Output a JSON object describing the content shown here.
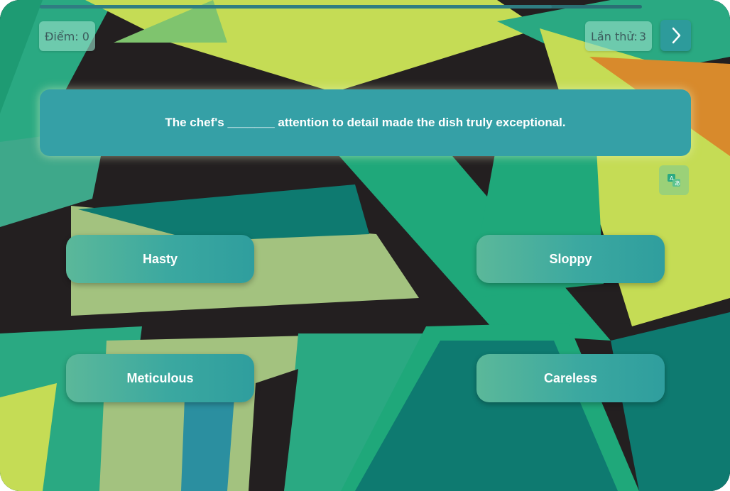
{
  "progress": {
    "fraction": 0.85
  },
  "score": {
    "label": "Điểm: 0"
  },
  "attempts": {
    "label": "Lần thử:",
    "value": "3"
  },
  "next_button": {
    "icon": "chevron-right-icon"
  },
  "question": {
    "text": "The chef's _______ attention to detail made the dish truly exceptional."
  },
  "translate_button": {
    "icon": "translate-icon"
  },
  "answers": [
    {
      "label": "Hasty"
    },
    {
      "label": "Sloppy"
    },
    {
      "label": "Meticulous"
    },
    {
      "label": "Careless"
    }
  ],
  "colors": {
    "background_dark": "#231f20",
    "teal": "#35a0a6",
    "green": "#1fa87a",
    "lime": "#c5dc55",
    "sage": "#9fc47e",
    "orange": "#d88a2c"
  }
}
